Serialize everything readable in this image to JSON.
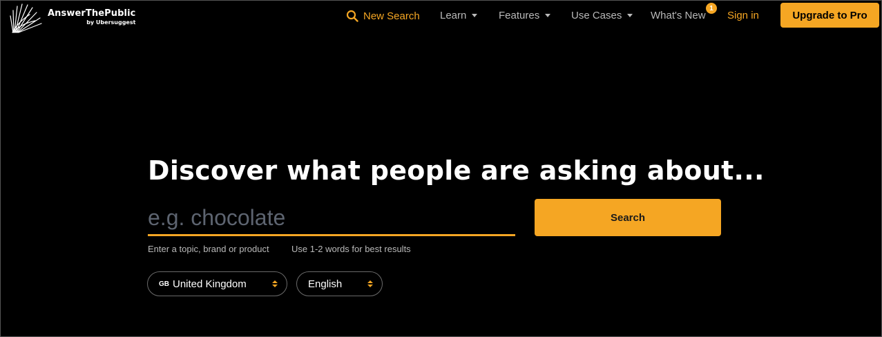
{
  "brand": {
    "title": "AnswerThePublic",
    "subtitle": "by Ubersuggest",
    "logo_icon": "dandelion-lines-icon"
  },
  "nav": {
    "new_search": "New Search",
    "learn": "Learn",
    "features": "Features",
    "use_cases": "Use Cases",
    "whats_new": "What's New",
    "whats_new_badge": "1",
    "sign_in": "Sign in",
    "upgrade": "Upgrade to Pro"
  },
  "hero": {
    "title": "Discover what people are asking about...",
    "search_placeholder": "e.g. chocolate",
    "search_value": "",
    "search_button": "Search",
    "hint_topic": "Enter a topic, brand or product",
    "hint_words": "Use 1-2 words for best results"
  },
  "filters": {
    "country_code": "GB",
    "country": "United Kingdom",
    "language": "English"
  },
  "colors": {
    "accent": "#f5a623",
    "background": "#000000",
    "muted_text": "#b9b9b9"
  }
}
